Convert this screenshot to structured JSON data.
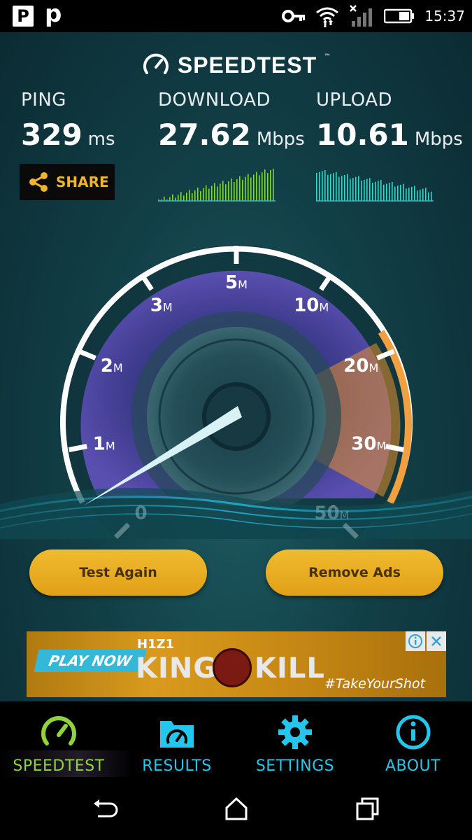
{
  "status_bar": {
    "left_icon_1": "P",
    "left_icon_2": "p",
    "icons": [
      "key-icon",
      "wifi-icon",
      "signal-icon",
      "battery-icon"
    ],
    "time": "15:37"
  },
  "header": {
    "logo_text": "SPEEDTEST",
    "trademark": "™"
  },
  "stats": {
    "ping": {
      "label": "PING",
      "value": "329",
      "unit": "ms"
    },
    "download": {
      "label": "DOWNLOAD",
      "value": "27.62",
      "unit": "Mbps"
    },
    "upload": {
      "label": "UPLOAD",
      "value": "10.61",
      "unit": "Mbps"
    }
  },
  "share": {
    "label": "SHARE"
  },
  "gauge": {
    "ticks": [
      {
        "num": "0",
        "unit": ""
      },
      {
        "num": "1",
        "unit": "M"
      },
      {
        "num": "2",
        "unit": "M"
      },
      {
        "num": "3",
        "unit": "M"
      },
      {
        "num": "5",
        "unit": "M"
      },
      {
        "num": "10",
        "unit": "M"
      },
      {
        "num": "20",
        "unit": "M"
      },
      {
        "num": "30",
        "unit": "M"
      },
      {
        "num": "50",
        "unit": "M"
      }
    ]
  },
  "buttons": {
    "test_again": "Test Again",
    "remove_ads": "Remove Ads"
  },
  "ad": {
    "play_now": "PLAY NOW",
    "brand": "H1Z1",
    "title_left": "KING",
    "title_right": "KILL",
    "hashtag": "#TakeYourShot",
    "info_icon": "info-icon",
    "close_icon": "close-icon"
  },
  "tabs": [
    {
      "label": "SPEEDTEST",
      "icon": "speedometer-icon",
      "active": true,
      "color": "#8fd43a"
    },
    {
      "label": "RESULTS",
      "icon": "folder-gauge-icon",
      "active": false,
      "color": "#25c6ec"
    },
    {
      "label": "SETTINGS",
      "icon": "gear-icon",
      "active": false,
      "color": "#25c6ec"
    },
    {
      "label": "ABOUT",
      "icon": "info-icon",
      "active": false,
      "color": "#25c6ec"
    }
  ],
  "nav": {
    "back": "back-icon",
    "home": "home-icon",
    "recents": "recents-icon"
  },
  "colors": {
    "accent_yellow": "#f0b429",
    "active_tab": "#8fd43a",
    "inactive_tab": "#25c6ec",
    "download_graph": "#7fd83a",
    "upload_graph": "#3fd3c8",
    "gauge_highlight": "#e8922a"
  }
}
